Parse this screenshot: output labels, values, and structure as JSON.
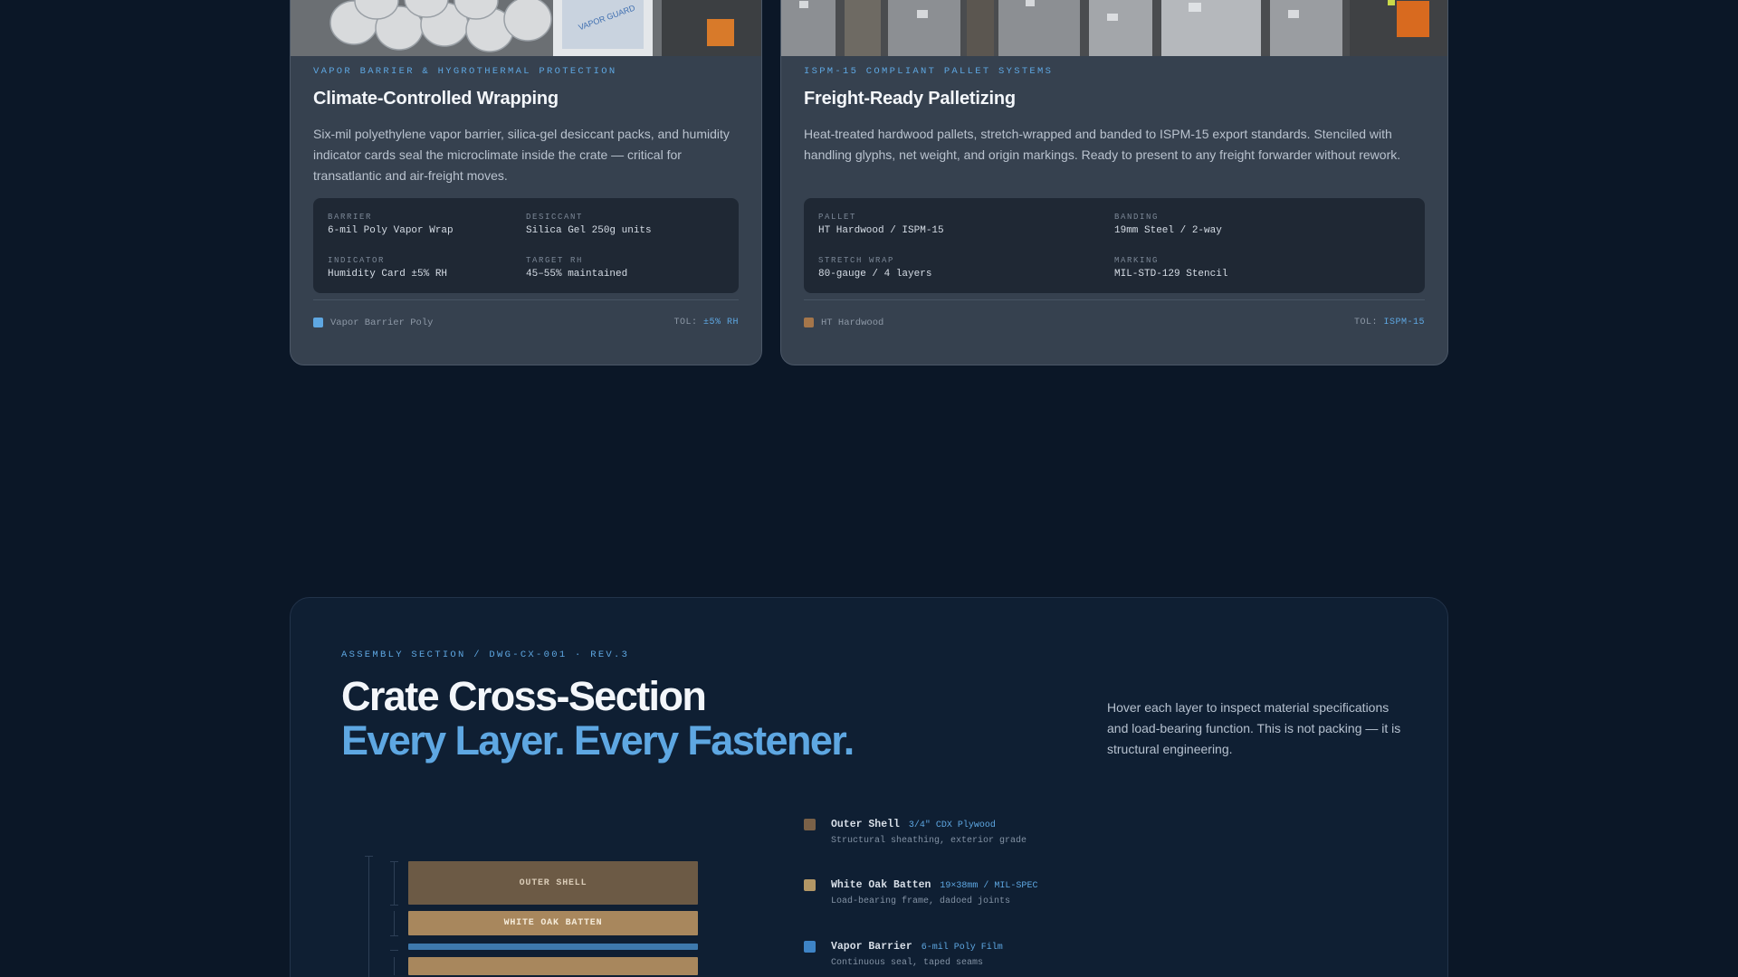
{
  "cards": [
    {
      "eyebrow": "VAPOR BARRIER & HYGROTHERMAL PROTECTION",
      "title": "Climate-Controlled Wrapping",
      "description": "Six-mil polyethylene vapor barrier, silica-gel desiccant packs, and humidity indicator cards seal the microclimate inside the crate — critical for transatlantic and air-freight moves.",
      "specs": [
        {
          "label": "BARRIER",
          "value": "6-mil Poly Vapor Wrap"
        },
        {
          "label": "DESICCANT",
          "value": "Silica Gel 250g units"
        },
        {
          "label": "INDICATOR",
          "value": "Humidity Card ±5% RH"
        },
        {
          "label": "TARGET RH",
          "value": "45–55% maintained"
        }
      ],
      "material": "Vapor Barrier Poly",
      "material_color": "#5ea7e2",
      "tol_label": "TOL:",
      "tol_value": "±5% RH"
    },
    {
      "eyebrow": "ISPM-15 COMPLIANT PALLET SYSTEMS",
      "title": "Freight-Ready Palletizing",
      "description": "Heat-treated hardwood pallets, stretch-wrapped and banded to ISPM-15 export standards. Stenciled with handling glyphs, net weight, and origin markings. Ready to present to any freight forwarder without rework.",
      "specs": [
        {
          "label": "PALLET",
          "value": "HT Hardwood / ISPM-15"
        },
        {
          "label": "BANDING",
          "value": "19mm Steel / 2-way"
        },
        {
          "label": "STRETCH WRAP",
          "value": "80-gauge / 4 layers"
        },
        {
          "label": "MARKING",
          "value": "MIL-STD-129 Stencil"
        }
      ],
      "material": "HT Hardwood",
      "material_color": "#a5764a",
      "tol_label": "TOL:",
      "tol_value": "ISPM-15"
    }
  ],
  "assembly": {
    "eyebrow": "ASSEMBLY SECTION / DWG-CX-001 · REV.3",
    "title_line1": "Crate Cross-Section",
    "title_line2": "Every Layer. Every Fastener.",
    "intro": "Hover each layer to inspect material specifications and load-bearing function. This is not packing — it is structural engineering.",
    "diagram_labels": {
      "outer_shell": "OUTER SHELL",
      "white_oak_batten": "WHITE OAK BATTEN"
    },
    "layers": [
      {
        "name": "Outer Shell",
        "spec": "3/4\" CDX Plywood",
        "desc": "Structural sheathing, exterior grade",
        "color": "#7a6148"
      },
      {
        "name": "White Oak Batten",
        "spec": "19×38mm / MIL-SPEC",
        "desc": "Load-bearing frame, dadoed joints",
        "color": "#b39766"
      },
      {
        "name": "Vapor Barrier",
        "spec": "6-mil Poly Film",
        "desc": "Continuous seal, taped seams",
        "color": "#3e84c6"
      }
    ]
  }
}
